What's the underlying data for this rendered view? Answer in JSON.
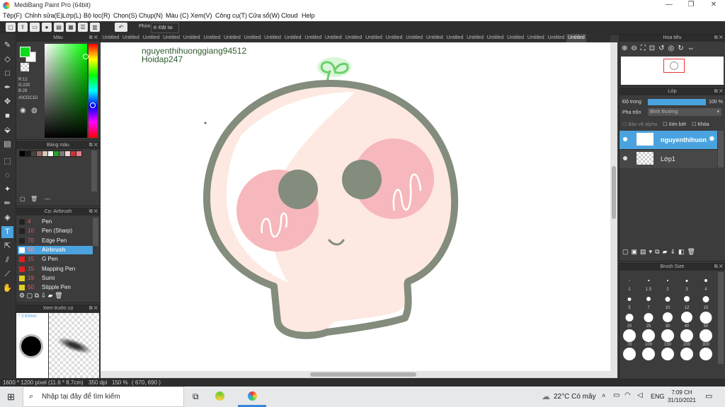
{
  "window": {
    "title": "MediBang Paint Pro (64bit)"
  },
  "menu": [
    "Tệp(F)",
    "Chỉnh sửa(E)",
    "Lớp(L)",
    "Bộ lọc(R)",
    "Chọn(S)",
    "Chụp(N)",
    "Màu (C)",
    "Xem(V)",
    "Công cụ(T)",
    "Cửa sổ(W)",
    "Cloud",
    "Help"
  ],
  "toolbar": {
    "snap_label": "Phím",
    "reset_label": "Đặt lại"
  },
  "color_panel": {
    "title": "Màu",
    "r": "R:12",
    "g": "G:220",
    "b": "B:29",
    "hex": "#0CDC1D",
    "fg_color": "#0cdc1d",
    "bg_color": "#ffffff"
  },
  "palette_panel": {
    "title": "Bảng màu",
    "swatches": [
      "#000000",
      "#1c1c1c",
      "#444444",
      "#9b6b63",
      "#d9c4b4",
      "#ffffff",
      "#2da02d",
      "#7a7a7a",
      "#f3d1d1",
      "#cc3333",
      "#e87a8a"
    ],
    "add_label": "---"
  },
  "brush_panel": {
    "title": "Cọ: Airbrush",
    "items": [
      {
        "num": "4",
        "name": "Pen",
        "color": "#222222"
      },
      {
        "num": "10",
        "name": "Pen (Sharp)",
        "color": "#222222"
      },
      {
        "num": "70",
        "name": "Edge Pen",
        "color": "#222222"
      },
      {
        "num": "50",
        "name": "Airbrush",
        "color": "#ffffff"
      },
      {
        "num": "15",
        "name": "G Pen",
        "color": "#e02020"
      },
      {
        "num": "15",
        "name": "Mapping Pen",
        "color": "#e02020"
      },
      {
        "num": "19",
        "name": "Sumi",
        "color": "#e0d020"
      },
      {
        "num": "50",
        "name": "Stipple Pen",
        "color": "#e0d020"
      }
    ],
    "selected_index": 3
  },
  "preview_panel": {
    "title": "Xem trước cọ",
    "size": "3.63mm"
  },
  "canvas": {
    "tab_label": "Untitled",
    "tab_count": 24,
    "watermark_line1": "nguyenthihuonggiang94512",
    "watermark_line2": "Hoidap247"
  },
  "navigator": {
    "title": "Hoa tiêu"
  },
  "layer_panel": {
    "title": "Lớp",
    "opacity_label": "Độ trong",
    "opacity_value": "100 %",
    "opacity_level": 1.0,
    "blend_label": "Pha trộn",
    "blend_value": "Bình thường",
    "protect_alpha": "Bảo vệ alpha",
    "clip": "Xén bớt",
    "lock": "Khóa",
    "layers": [
      {
        "name": "nguyenthihuon",
        "selected": true
      },
      {
        "name": "Lớp1",
        "selected": false
      }
    ]
  },
  "brush_size_panel": {
    "title": "Brush Size",
    "sizes": [
      "1",
      "1.5",
      "2",
      "3",
      "4",
      "5",
      "7",
      "10",
      "12",
      "15",
      "20",
      "25",
      "30",
      "40",
      "50",
      "70",
      "100",
      "150",
      "200",
      "300",
      "",
      "",
      "",
      "",
      ""
    ]
  },
  "status": {
    "dimensions": "1600 * 1200 pixel",
    "physical": "(11.6 * 8.7cm)",
    "dpi": "350 dpi",
    "zoom": "150 %",
    "coords": "( 670, 690 )"
  },
  "taskbar": {
    "search_placeholder": "Nhập tại đây để tìm kiếm",
    "weather": "22°C  Có mây",
    "lang": "ENG",
    "time": "7:09 CH",
    "date": "31/10/2021"
  }
}
